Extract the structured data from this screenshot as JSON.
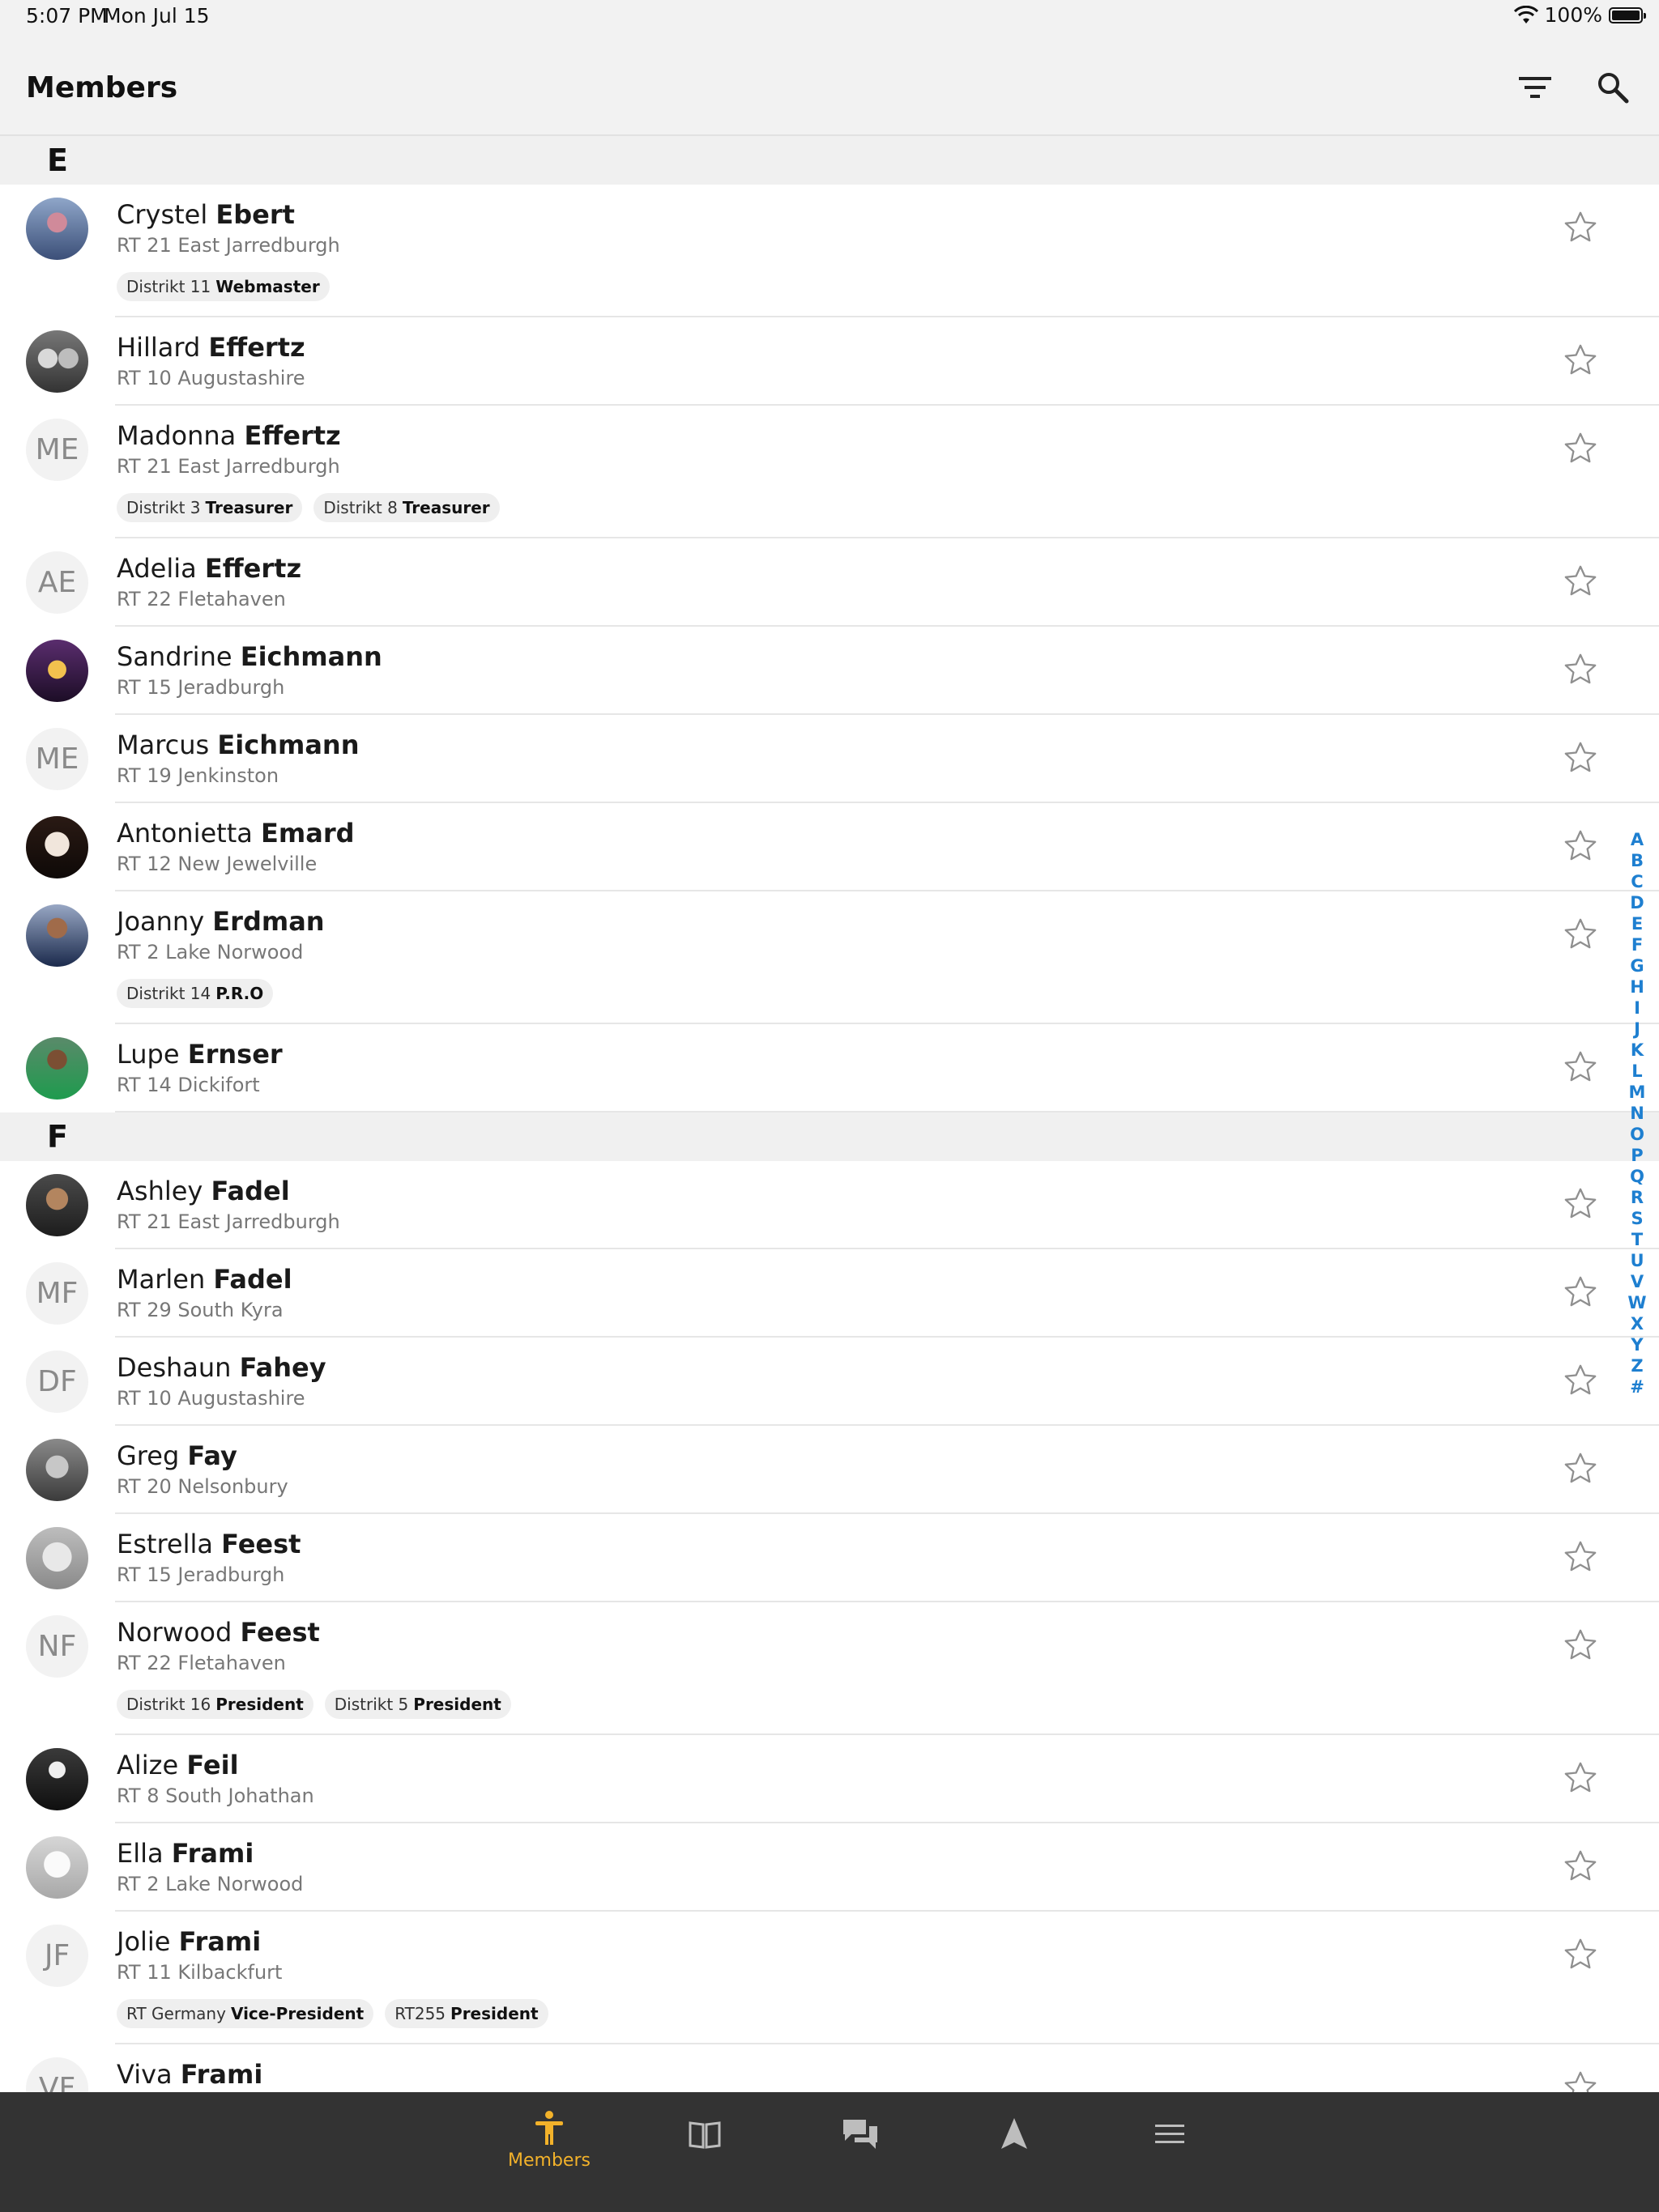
{
  "status": {
    "time": "5:07 PM",
    "date": "Mon Jul 15",
    "battery": "100%"
  },
  "header": {
    "title": "Members"
  },
  "sections": [
    {
      "letter": "E",
      "members": [
        {
          "first": "Crystel",
          "last": "Ebert",
          "sub": "RT 21 East Jarredburgh",
          "avatar": "photo",
          "roles": [
            {
              "org": "Distrikt 11",
              "role": "Webmaster"
            }
          ]
        },
        {
          "first": "Hillard",
          "last": "Effertz",
          "sub": "RT 10 Augustashire",
          "avatar": "photo",
          "roles": []
        },
        {
          "first": "Madonna",
          "last": "Effertz",
          "sub": "RT 21 East Jarredburgh",
          "initials": "ME",
          "roles": [
            {
              "org": "Distrikt 3",
              "role": "Treasurer"
            },
            {
              "org": "Distrikt 8",
              "role": "Treasurer"
            }
          ]
        },
        {
          "first": "Adelia",
          "last": "Effertz",
          "sub": "RT 22 Fletahaven",
          "initials": "AE",
          "roles": []
        },
        {
          "first": "Sandrine",
          "last": "Eichmann",
          "sub": "RT 15 Jeradburgh",
          "avatar": "photo",
          "roles": []
        },
        {
          "first": "Marcus",
          "last": "Eichmann",
          "sub": "RT 19 Jenkinston",
          "initials": "ME",
          "roles": []
        },
        {
          "first": "Antonietta",
          "last": "Emard",
          "sub": "RT 12 New Jewelville",
          "avatar": "photo",
          "roles": []
        },
        {
          "first": "Joanny",
          "last": "Erdman",
          "sub": "RT 2 Lake Norwood",
          "avatar": "photo",
          "roles": [
            {
              "org": "Distrikt 14",
              "role": "P.R.O"
            }
          ]
        },
        {
          "first": "Lupe",
          "last": "Ernser",
          "sub": "RT 14 Dickifort",
          "avatar": "photo",
          "roles": []
        }
      ]
    },
    {
      "letter": "F",
      "members": [
        {
          "first": "Ashley",
          "last": "Fadel",
          "sub": "RT 21 East Jarredburgh",
          "avatar": "photo",
          "roles": []
        },
        {
          "first": "Marlen",
          "last": "Fadel",
          "sub": "RT 29 South Kyra",
          "initials": "MF",
          "roles": []
        },
        {
          "first": "Deshaun",
          "last": "Fahey",
          "sub": "RT 10 Augustashire",
          "initials": "DF",
          "roles": []
        },
        {
          "first": "Greg",
          "last": "Fay",
          "sub": "RT 20 Nelsonbury",
          "avatar": "photo",
          "roles": []
        },
        {
          "first": "Estrella",
          "last": "Feest",
          "sub": "RT 15 Jeradburgh",
          "avatar": "photo",
          "roles": []
        },
        {
          "first": "Norwood",
          "last": "Feest",
          "sub": "RT 22 Fletahaven",
          "initials": "NF",
          "roles": [
            {
              "org": "Distrikt 16",
              "role": "President"
            },
            {
              "org": "Distrikt 5",
              "role": "President"
            }
          ]
        },
        {
          "first": "Alize",
          "last": "Feil",
          "sub": "RT 8 South Johathan",
          "avatar": "photo",
          "roles": []
        },
        {
          "first": "Ella",
          "last": "Frami",
          "sub": "RT 2 Lake Norwood",
          "avatar": "photo",
          "roles": []
        },
        {
          "first": "Jolie",
          "last": "Frami",
          "sub": "RT 11 Kilbackfurt",
          "initials": "JF",
          "roles": [
            {
              "org": "RT Germany",
              "role": "Vice-President"
            },
            {
              "org": "RT255",
              "role": "President"
            }
          ]
        },
        {
          "first": "Viva",
          "last": "Frami",
          "sub": "",
          "initials": "VF",
          "roles": []
        }
      ]
    }
  ],
  "index": [
    "A",
    "B",
    "C",
    "D",
    "E",
    "F",
    "G",
    "H",
    "I",
    "J",
    "K",
    "L",
    "M",
    "N",
    "O",
    "P",
    "Q",
    "R",
    "S",
    "T",
    "U",
    "V",
    "W",
    "X",
    "Y",
    "Z",
    "#"
  ],
  "tabs": [
    {
      "name": "members",
      "label": "Members",
      "icon": "person-icon",
      "active": true
    },
    {
      "name": "book",
      "label": "",
      "icon": "book-icon",
      "active": false
    },
    {
      "name": "chat",
      "label": "",
      "icon": "chat-icon",
      "active": false
    },
    {
      "name": "navigate",
      "label": "",
      "icon": "navigation-arrow-icon",
      "active": false
    },
    {
      "name": "menu",
      "label": "",
      "icon": "menu-icon",
      "active": false
    }
  ],
  "colors": {
    "accent": "#f3b22a",
    "index": "#1e7fd0",
    "tabbar": "#333333"
  }
}
